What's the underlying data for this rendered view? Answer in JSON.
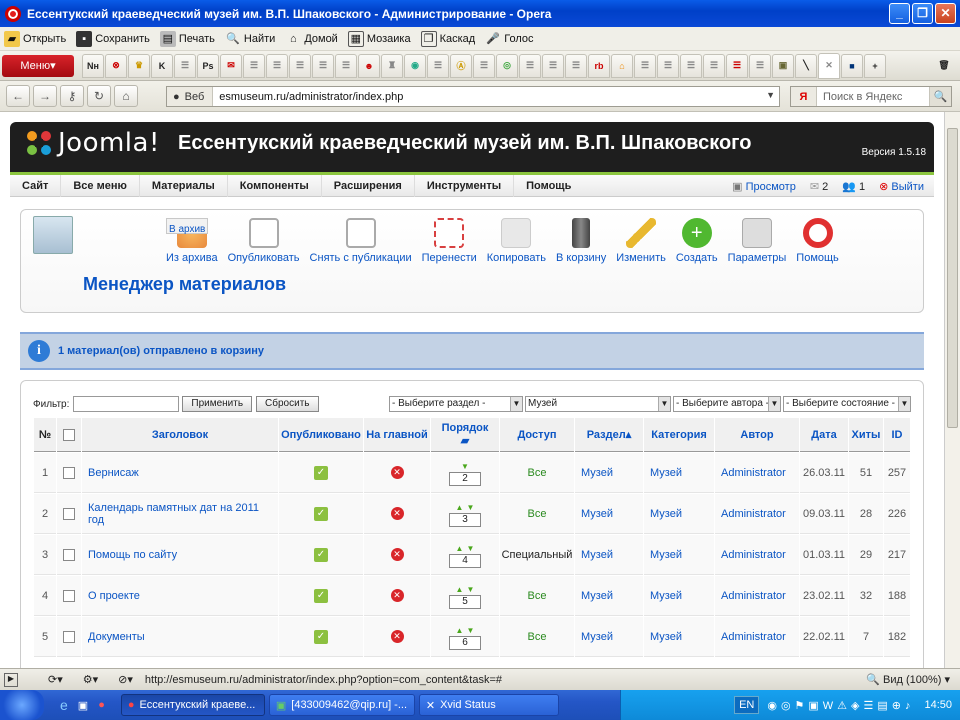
{
  "window": {
    "title": "Ессентукский краеведческий музей им. В.П. Шпаковского - Администрирование - Opera"
  },
  "menubar": [
    {
      "label": "Открыть",
      "icon": "folder-icon"
    },
    {
      "label": "Сохранить",
      "icon": "save-icon"
    },
    {
      "label": "Печать",
      "icon": "print-icon"
    },
    {
      "label": "Найти",
      "icon": "find-icon"
    },
    {
      "label": "Домой",
      "icon": "home-icon"
    },
    {
      "label": "Мозаика",
      "icon": "tile-icon"
    },
    {
      "label": "Каскад",
      "icon": "cascade-icon"
    },
    {
      "label": "Голос",
      "icon": "voice-icon"
    }
  ],
  "opera_menu": "Меню",
  "address": {
    "prefix": "Веб",
    "url": "esmuseum.ru/administrator/index.php"
  },
  "search": {
    "engine": "Я",
    "placeholder": "Поиск в Яндекс"
  },
  "joomla": {
    "logo_text": "Joomla!",
    "site_title": "Ессентукский краеведческий музей им. В.П. Шпаковского",
    "version": "Версия 1.5.18",
    "menu": [
      "Сайт",
      "Все меню",
      "Материалы",
      "Компоненты",
      "Расширения",
      "Инструменты",
      "Помощь"
    ],
    "right": {
      "preview": "Просмотр",
      "messages": "2",
      "users": "1",
      "logout": "Выйти"
    }
  },
  "toolbar": [
    {
      "label": "Из архива",
      "color": "#e8893c"
    },
    {
      "label": "В архив",
      "color": "#e8893c"
    },
    {
      "label": "Опубликовать",
      "color": "#8cc040"
    },
    {
      "label": "Снять с публикации",
      "color": "#e04848"
    },
    {
      "label": "Перенести",
      "color": "#d84040"
    },
    {
      "label": "Копировать",
      "color": "#d8d8d8"
    },
    {
      "label": "В корзину",
      "color": "#555555"
    },
    {
      "label": "Изменить",
      "color": "#e8b830"
    },
    {
      "label": "Создать",
      "color": "#50b830"
    },
    {
      "label": "Параметры",
      "color": "#a8a8a8"
    },
    {
      "label": "Помощь",
      "color": "#e03030"
    }
  ],
  "page_title": "Менеджер материалов",
  "message": "1 материал(ов) отправлено в корзину",
  "filter": {
    "label": "Фильтр:",
    "apply": "Применить",
    "reset": "Сбросить",
    "section": "- Выберите раздел -",
    "category": "Музей",
    "author": "- Выберите автора -",
    "state": "- Выберите состояние -"
  },
  "table": {
    "headers": {
      "num": "№",
      "title": "Заголовок",
      "published": "Опубликовано",
      "front": "На главной",
      "order": "Порядок",
      "access": "Доступ",
      "section": "Раздел",
      "category": "Категория",
      "author": "Автор",
      "date": "Дата",
      "hits": "Хиты",
      "id": "ID"
    },
    "rows": [
      {
        "num": "1",
        "title": "Вернисаж",
        "order": "2",
        "access": "Все",
        "section": "Музей",
        "category": "Музей",
        "author": "Administrator",
        "date": "26.03.11",
        "hits": "51",
        "id": "257"
      },
      {
        "num": "2",
        "title": "Календарь памятных дат на 2011 год",
        "order": "3",
        "access": "Все",
        "section": "Музей",
        "category": "Музей",
        "author": "Administrator",
        "date": "09.03.11",
        "hits": "28",
        "id": "226"
      },
      {
        "num": "3",
        "title": "Помощь по сайту",
        "order": "4",
        "access": "Специальный",
        "section": "Музей",
        "category": "Музей",
        "author": "Administrator",
        "date": "01.03.11",
        "hits": "29",
        "id": "217"
      },
      {
        "num": "4",
        "title": "О проекте",
        "order": "5",
        "access": "Все",
        "section": "Музей",
        "category": "Музей",
        "author": "Administrator",
        "date": "23.02.11",
        "hits": "32",
        "id": "188"
      },
      {
        "num": "5",
        "title": "Документы",
        "order": "6",
        "access": "Все",
        "section": "Музей",
        "category": "Музей",
        "author": "Administrator",
        "date": "22.02.11",
        "hits": "7",
        "id": "182"
      }
    ]
  },
  "status": {
    "url": "http://esmuseum.ru/administrator/index.php?option=com_content&task=#",
    "zoom": "Вид (100%)"
  },
  "taskbar": {
    "start": "",
    "tasks": [
      "Ессентукский краеве...",
      "[433009462@qip.ru] -...",
      "Xvid Status"
    ],
    "lang": "EN",
    "clock": "14:50"
  }
}
